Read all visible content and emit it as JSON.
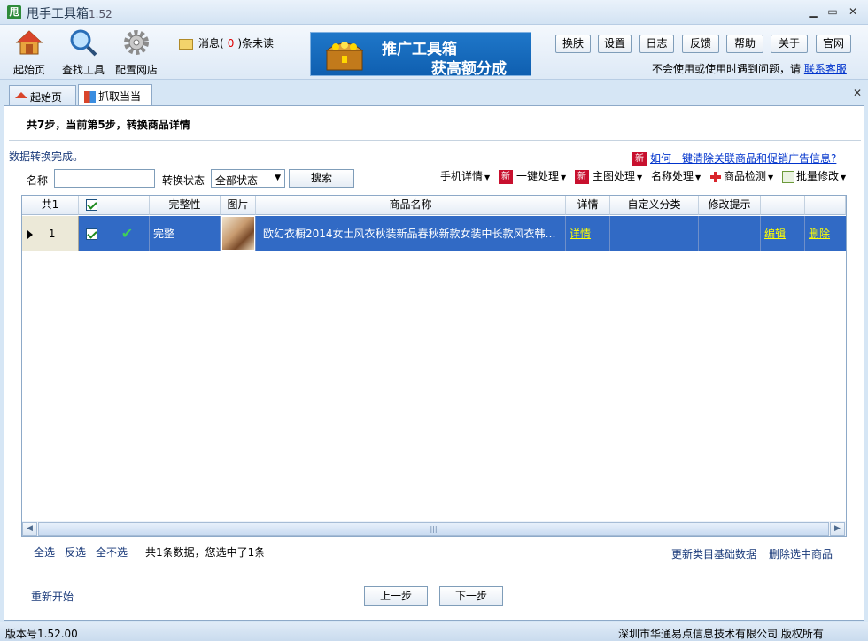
{
  "window": {
    "title": "甩手工具箱",
    "version": "1.52",
    "icon_char": "甩"
  },
  "toolbar": {
    "items": [
      {
        "label": "起始页",
        "icon": "house-icon"
      },
      {
        "label": "查找工具",
        "icon": "magnifier-icon"
      },
      {
        "label": "配置网店",
        "icon": "gear-icon"
      }
    ],
    "message": {
      "prefix": "消息(",
      "count": "0",
      "suffix": ")条未读"
    },
    "banner": {
      "line1": "推广工具箱",
      "line2": "获高额分成"
    },
    "buttons": [
      "换肤",
      "设置",
      "日志",
      "反馈",
      "帮助",
      "关于",
      "官网"
    ],
    "help_text": "不会使用或使用时遇到问题，请",
    "help_link": "联系客服"
  },
  "tabs": [
    {
      "label": "起始页",
      "icon": "house-icon"
    },
    {
      "label": "抓取当当",
      "icon": "grab-icon"
    }
  ],
  "main": {
    "step_text": "共7步，当前第5步，转换商品详情",
    "done_text": "数据转换完成。",
    "faq_badge": "新",
    "faq_link": "如何一键清除关联商品和促销广告信息?",
    "filter": {
      "name_label": "名称",
      "name_value": "",
      "status_label": "转换状态",
      "status_value": "全部状态",
      "search_label": "搜索"
    },
    "ops": [
      {
        "label": "手机详情",
        "badge": ""
      },
      {
        "label": "一键处理",
        "badge": "新"
      },
      {
        "label": "主图处理",
        "badge": "新"
      },
      {
        "label": "名称处理",
        "badge": ""
      },
      {
        "label": "商品检测",
        "badge": "cross"
      },
      {
        "label": "批量修改",
        "badge": "doc"
      }
    ]
  },
  "grid": {
    "headers": {
      "total": "共1",
      "complete": "完整性",
      "image": "图片",
      "name": "商品名称",
      "detail": "详情",
      "category": "自定义分类",
      "hint": "修改提示"
    },
    "rows": [
      {
        "index": "1",
        "complete": "完整",
        "name": "欧幻衣橱2014女士风衣秋装新品春秋新款女装中长款风衣韩…",
        "detail": "详情",
        "edit": "编辑",
        "delete": "删除"
      }
    ]
  },
  "footer": {
    "select_all": "全选",
    "invert": "反选",
    "select_none": "全不选",
    "selection_info": "共1条数据，您选中了1条",
    "update_category": "更新类目基础数据",
    "delete_selected": "删除选中商品",
    "restart": "重新开始",
    "prev": "上一步",
    "next": "下一步"
  },
  "statusbar": {
    "version": "版本号1.52.00",
    "copyright": "深圳市华通易点信息技术有限公司  版权所有"
  }
}
